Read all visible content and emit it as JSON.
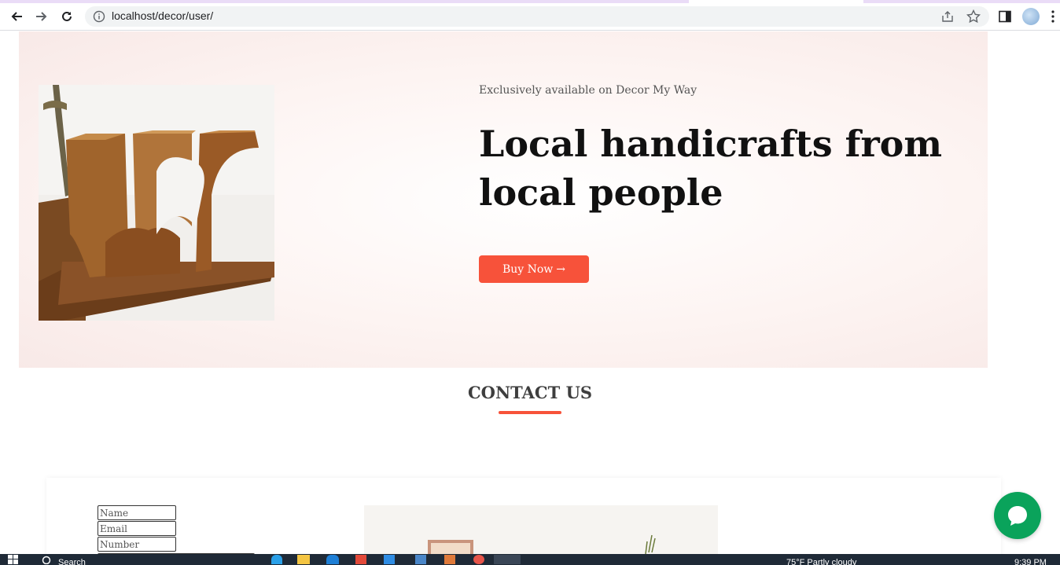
{
  "browser": {
    "url": "localhost/decor/user/"
  },
  "hero": {
    "eyebrow": "Exclusively available on Decor My Way",
    "headline": "Local handicrafts from local people",
    "button_label": "Buy Now",
    "button_arrow": "→",
    "image": "wooden-heart-candle-holders"
  },
  "contact": {
    "title": "CONTACT US",
    "fields": {
      "name_placeholder": "Name",
      "email_placeholder": "Email",
      "number_placeholder": "Number"
    }
  },
  "taskbar": {
    "search_text": "Search",
    "weather": "75°F  Partly cloudy",
    "time": "9:39 PM"
  },
  "colors": {
    "accent": "#f7523a",
    "chat": "#0aa35b",
    "heading": "#111111"
  },
  "icons": [
    "back-arrow-icon",
    "forward-arrow-icon",
    "reload-icon",
    "info-icon",
    "share-icon",
    "star-icon",
    "side-panel-icon",
    "menu-kebab-icon",
    "chat-bubble-icon",
    "windows-start-icon",
    "search-icon"
  ]
}
